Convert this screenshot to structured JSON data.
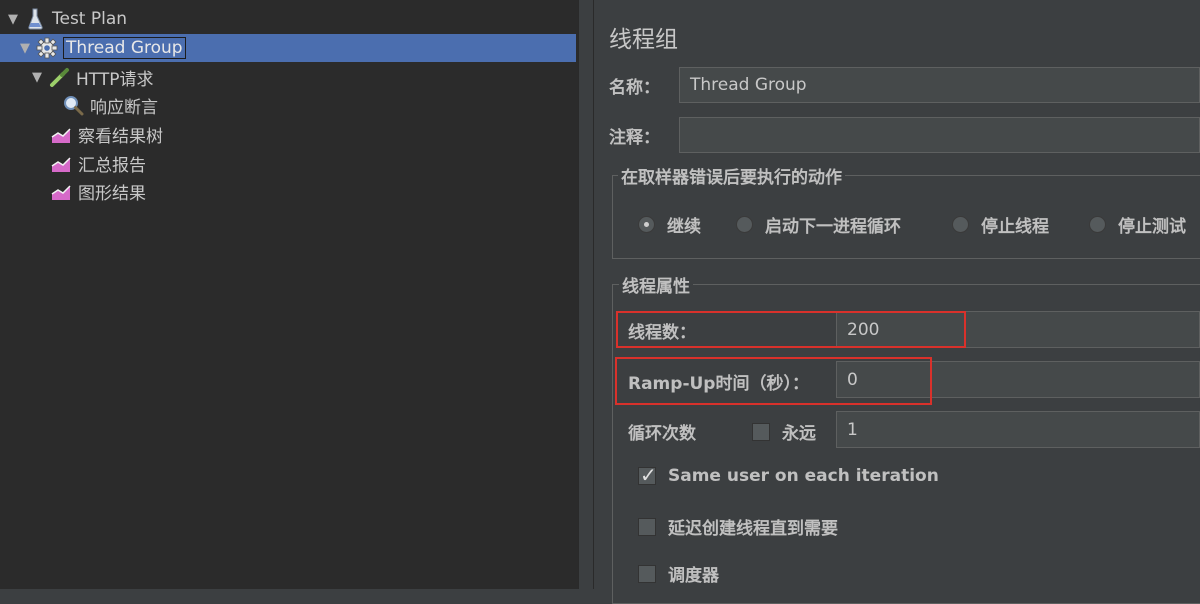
{
  "tree": {
    "items": [
      {
        "label": "Test Plan",
        "icon": "flask-icon"
      },
      {
        "label": "Thread Group",
        "icon": "gear-icon"
      },
      {
        "label": "HTTP请求",
        "icon": "pipette-icon"
      },
      {
        "label": "响应断言",
        "icon": "magnifier-icon"
      },
      {
        "label": "察看结果树",
        "icon": "graph-icon"
      },
      {
        "label": "汇总报告",
        "icon": "graph-icon"
      },
      {
        "label": "图形结果",
        "icon": "graph-icon"
      }
    ]
  },
  "panel": {
    "title": "线程组",
    "name_label": "名称：",
    "name_value": "Thread Group",
    "comment_label": "注释：",
    "comment_value": "",
    "error_action": {
      "title": "在取样器错误后要执行的动作",
      "options": [
        "继续",
        "启动下一进程循环",
        "停止线程",
        "停止测试"
      ],
      "selected": "继续"
    },
    "thread_props": {
      "title": "线程属性",
      "threads_label": "线程数：",
      "threads_value": "200",
      "rampup_label": "Ramp-Up时间（秒）：",
      "rampup_value": "0",
      "loop_label": "循环次数",
      "forever_label": "永远",
      "forever_checked": false,
      "loop_value": "1",
      "same_user_label": "Same user on each iteration",
      "same_user_checked": true,
      "delay_label": "延迟创建线程直到需要",
      "delay_checked": false,
      "scheduler_label": "调度器",
      "scheduler_checked": false
    }
  },
  "colors": {
    "selection": "#4b6eaf",
    "highlight_border": "#d9312b"
  }
}
